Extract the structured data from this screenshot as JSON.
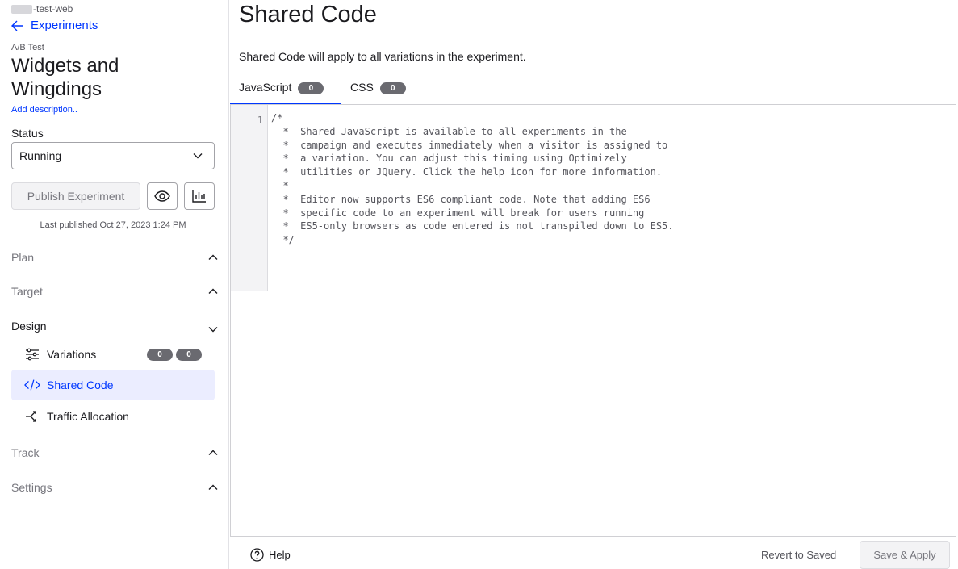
{
  "sidebar": {
    "project_name": "-test-web",
    "back_label": "Experiments",
    "experiment_type": "A/B Test",
    "experiment_title": "Widgets and Wingdings",
    "add_description": "Add description..",
    "status_label": "Status",
    "status_value": "Running",
    "publish_label": "Publish Experiment",
    "last_published": "Last published Oct 27, 2023 1:24 PM",
    "sections": {
      "plan": "Plan",
      "target": "Target",
      "design": "Design",
      "track": "Track",
      "settings": "Settings"
    },
    "design_items": {
      "variations": {
        "label": "Variations",
        "badge1": "0",
        "badge2": "0"
      },
      "shared_code": {
        "label": "Shared Code"
      },
      "traffic_allocation": {
        "label": "Traffic Allocation"
      }
    },
    "icons": [
      "arrow-left-icon",
      "chevron-down-icon",
      "eye-icon",
      "bar-chart-icon",
      "chevron-up-icon",
      "sliders-icon",
      "code-icon",
      "split-icon"
    ]
  },
  "main": {
    "title": "Shared Code",
    "subtitle": "Shared Code will apply to all variations in the experiment.",
    "tabs": {
      "javascript": {
        "label": "JavaScript",
        "count": "0"
      },
      "css": {
        "label": "CSS",
        "count": "0"
      }
    },
    "editor": {
      "line_number": "1",
      "code": "/*\n  *  Shared JavaScript is available to all experiments in the\n  *  campaign and executes immediately when a visitor is assigned to\n  *  a variation. You can adjust this timing using Optimizely\n  *  utilities or JQuery. Click the help icon for more information.\n  *\n  *  Editor now supports ES6 compliant code. Note that adding ES6\n  *  specific code to an experiment will break for users running\n  *  ES5-only browsers as code entered is not transpiled down to ES5.\n  */"
    },
    "footer": {
      "help_label": "Help",
      "revert_label": "Revert to Saved",
      "save_label": "Save & Apply"
    }
  },
  "colors": {
    "accent": "#0037ff",
    "active_bg": "#ebedff",
    "badge_bg": "#6a6a70"
  }
}
